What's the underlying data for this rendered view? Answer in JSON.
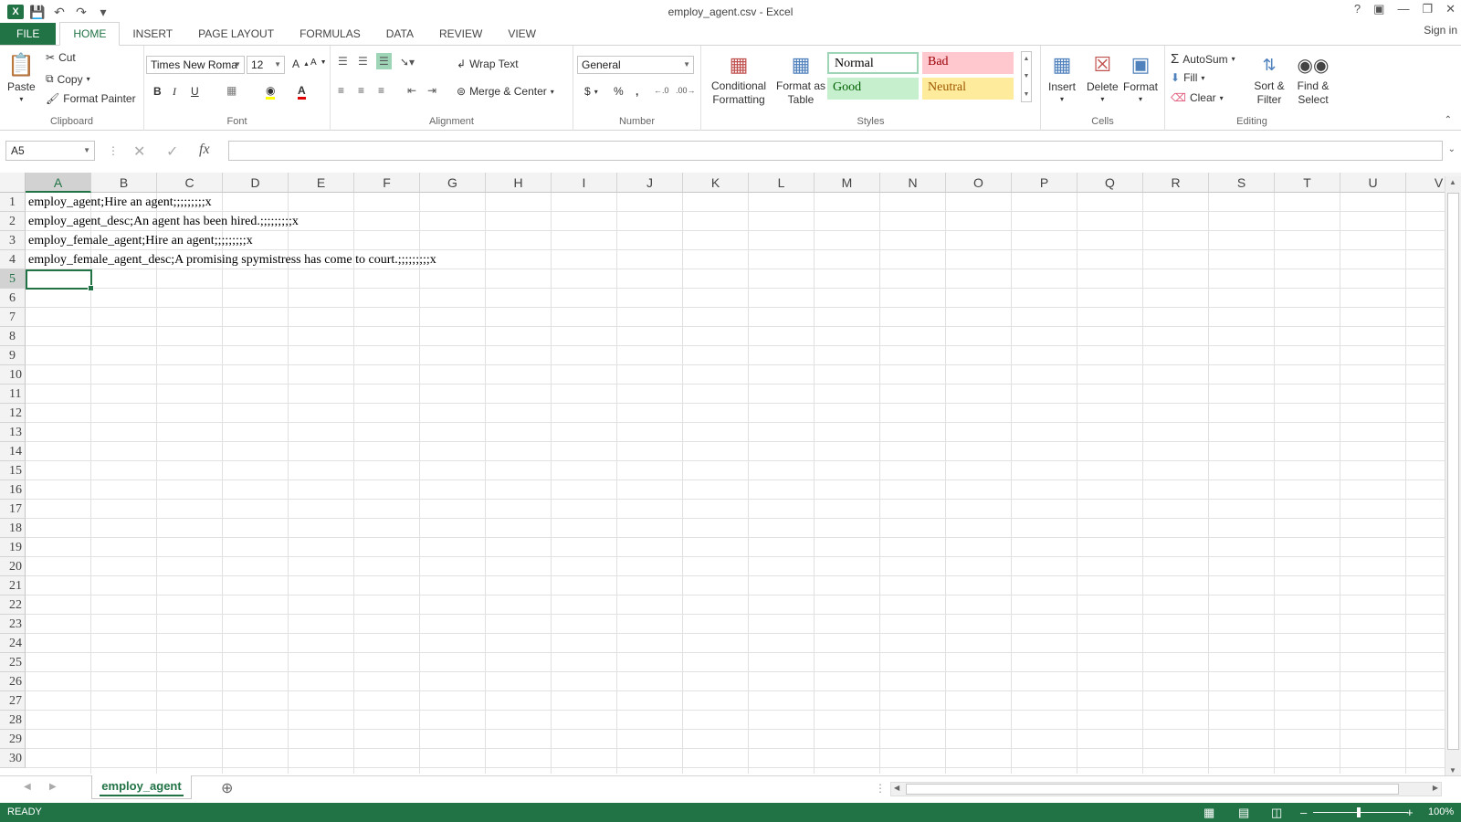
{
  "window": {
    "title": "employ_agent.csv - Excel"
  },
  "tabs": [
    "FILE",
    "HOME",
    "INSERT",
    "PAGE LAYOUT",
    "FORMULAS",
    "DATA",
    "REVIEW",
    "VIEW"
  ],
  "signin": "Sign in",
  "clipboard": {
    "paste": "Paste",
    "cut": "Cut",
    "copy": "Copy",
    "format_painter": "Format Painter",
    "label": "Clipboard"
  },
  "font": {
    "name": "Times New Roma",
    "size": "12",
    "label": "Font",
    "bold": "B",
    "italic": "I",
    "underline": "U"
  },
  "alignment": {
    "wrap": "Wrap Text",
    "merge": "Merge & Center",
    "label": "Alignment"
  },
  "number": {
    "format": "General",
    "currency": "$",
    "percent": "%",
    "comma": ",",
    "label": "Number"
  },
  "styles": {
    "conditional": "Conditional Formatting",
    "format_table": "Format as Table",
    "normal": "Normal",
    "bad": "Bad",
    "good": "Good",
    "neutral": "Neutral",
    "label": "Styles"
  },
  "cells_group": {
    "insert": "Insert",
    "delete": "Delete",
    "format": "Format",
    "label": "Cells"
  },
  "editing": {
    "autosum": "AutoSum",
    "fill": "Fill",
    "clear": "Clear",
    "sort": "Sort & Filter",
    "find": "Find & Select",
    "label": "Editing"
  },
  "formula": {
    "namebox": "A5",
    "value": ""
  },
  "columns": [
    "A",
    "B",
    "C",
    "D",
    "E",
    "F",
    "G",
    "H",
    "I",
    "J",
    "K",
    "L",
    "M",
    "N",
    "O",
    "P",
    "Q",
    "R",
    "S",
    "T",
    "U",
    "V"
  ],
  "rows": [
    "1",
    "2",
    "3",
    "4",
    "5",
    "6",
    "7",
    "8",
    "9",
    "10",
    "11",
    "12",
    "13",
    "14",
    "15",
    "16",
    "17",
    "18",
    "19",
    "20",
    "21",
    "22",
    "23",
    "24",
    "25",
    "26",
    "27",
    "28",
    "29",
    "30"
  ],
  "cell_values": [
    "employ_agent;Hire an agent;;;;;;;;;x",
    "employ_agent_desc;An agent has been hired.;;;;;;;;;x",
    "employ_female_agent;Hire an agent;;;;;;;;;x",
    "employ_female_agent_desc;A promising spymistress has come to court.;;;;;;;;;x"
  ],
  "sheet": {
    "name": "employ_agent"
  },
  "status": {
    "mode": "READY",
    "zoom": "100%"
  },
  "colors": {
    "accent": "#217346",
    "bad_bg": "#ffc7ce",
    "bad_fg": "#9c0006",
    "good_bg": "#c6efce",
    "good_fg": "#006100",
    "neutral_bg": "#ffeb9c",
    "neutral_fg": "#9c5700"
  }
}
